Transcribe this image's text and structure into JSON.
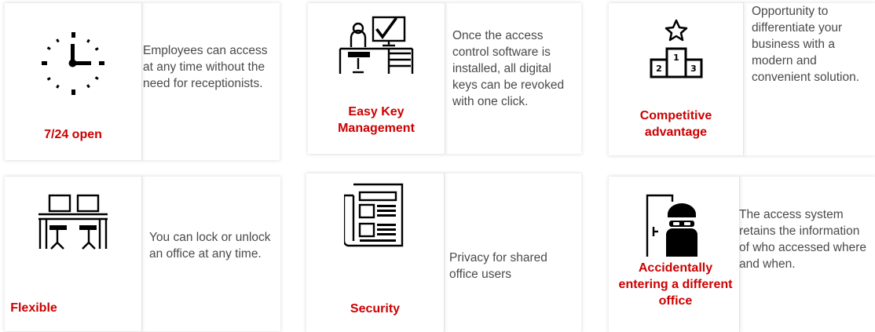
{
  "colors": {
    "accent": "#cc0000",
    "text": "#4a4a4a",
    "icon": "#000000"
  },
  "cards": [
    {
      "icon": "clock-icon",
      "title": "7/24 open",
      "description": "Employees can access at any time without the need for receptionists."
    },
    {
      "icon": "computer-desk-icon",
      "title": "Easy Key Management",
      "description": "Once the access control software is installed, all digital keys can be revoked with one click."
    },
    {
      "icon": "podium-icon",
      "title": "Competitive advantage",
      "description": "Opportunity to differentiate your business with a modern and convenient solution."
    },
    {
      "icon": "shared-desks-icon",
      "title": "Flexible",
      "description": "You can lock or unlock an office at any time."
    },
    {
      "icon": "newspaper-icon",
      "title": "Security",
      "description": "Privacy for shared office users"
    },
    {
      "icon": "intruder-door-icon",
      "title": "Accidentally entering a different office",
      "description": "The access system retains the information of who accessed where and when."
    }
  ]
}
